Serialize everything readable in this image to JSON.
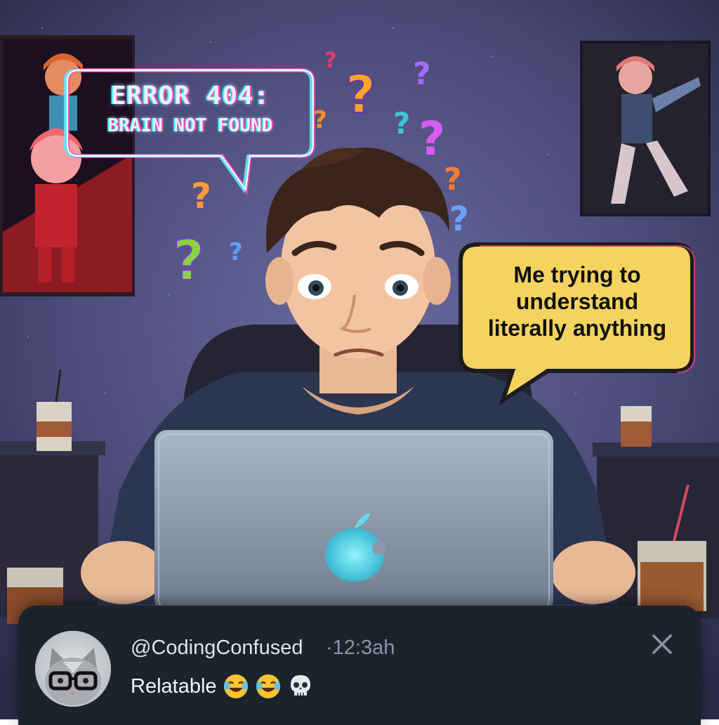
{
  "error_bubble": {
    "line1": "ERROR 404:",
    "line2": "BRAIN NOT FOUND"
  },
  "caption_bubble": {
    "line1": "Me trying to",
    "line2": "understand",
    "line3": "literally anything"
  },
  "notification": {
    "handle": "@CodingConfused",
    "time": "·12:3ah",
    "text": "Relatable",
    "emoji_icons": [
      "laughing-crying-icon",
      "laughing-crying-icon",
      "skull-icon"
    ],
    "close_icon": "close-icon"
  },
  "colors": {
    "wall": "#4b4a78",
    "notification_bg": "#1b232c",
    "caption_bubble_bg": "#f4d35e",
    "laptop": "#9aa7b8",
    "apple_logo_glow": "#57d6e8"
  }
}
